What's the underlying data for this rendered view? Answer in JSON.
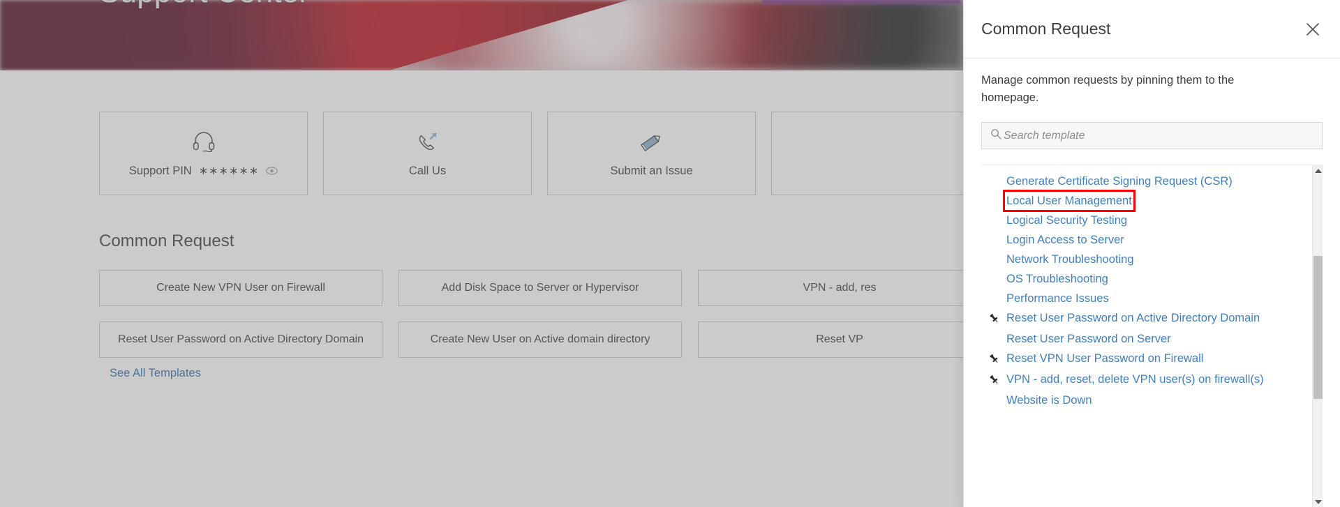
{
  "hero": {
    "title": "Support Center"
  },
  "cards": [
    {
      "label": "Support PIN",
      "icon": "headset-icon",
      "pin_mask": "∗∗∗∗∗∗",
      "has_reveal": true
    },
    {
      "label": "Call Us",
      "icon": "phone-outgoing-icon",
      "has_reveal": false
    },
    {
      "label": "Submit an Issue",
      "icon": "pencil-icon",
      "has_reveal": false
    },
    {
      "label": "",
      "icon": "",
      "has_reveal": false
    }
  ],
  "common_request": {
    "heading": "Common Request",
    "buttons": [
      "Create New VPN User on Firewall",
      "Add Disk Space to Server or Hypervisor",
      "VPN - add, res",
      "Reset User Password on Active Directory Domain",
      "Create New User on Active domain directory",
      "Reset VP"
    ],
    "see_all_label": "See All Templates"
  },
  "drawer": {
    "title": "Common Request",
    "close_icon": "close-icon",
    "description": "Manage common requests by pinning them to the homepage.",
    "search": {
      "placeholder": "Search template",
      "value": "",
      "icon": "search-icon"
    },
    "scrollbar": {
      "up_icon": "chevron-up-icon",
      "down_icon": "chevron-down-icon"
    },
    "templates": [
      {
        "label": "Generate Certificate Signing Request (CSR)",
        "pinned": false,
        "highlighted": false
      },
      {
        "label": "Local User Management",
        "pinned": false,
        "highlighted": true
      },
      {
        "label": "Logical Security Testing",
        "pinned": false,
        "highlighted": false
      },
      {
        "label": "Login Access to Server",
        "pinned": false,
        "highlighted": false
      },
      {
        "label": "Network Troubleshooting",
        "pinned": false,
        "highlighted": false
      },
      {
        "label": "OS Troubleshooting",
        "pinned": false,
        "highlighted": false
      },
      {
        "label": "Performance Issues",
        "pinned": false,
        "highlighted": false
      },
      {
        "label": "Reset User Password on Active Directory Domain",
        "pinned": true,
        "highlighted": false
      },
      {
        "label": "Reset User Password on Server",
        "pinned": false,
        "highlighted": false
      },
      {
        "label": "Reset VPN User Password on Firewall",
        "pinned": true,
        "highlighted": false
      },
      {
        "label": "VPN - add, reset, delete VPN user(s) on firewall(s)",
        "pinned": true,
        "highlighted": false
      },
      {
        "label": "Website is Down",
        "pinned": false,
        "highlighted": false
      }
    ]
  },
  "colors": {
    "link": "#3f7fc1",
    "highlight": "#ff0000",
    "accent_blue": "#8fb0cd",
    "banner_red": "#8e1522"
  }
}
